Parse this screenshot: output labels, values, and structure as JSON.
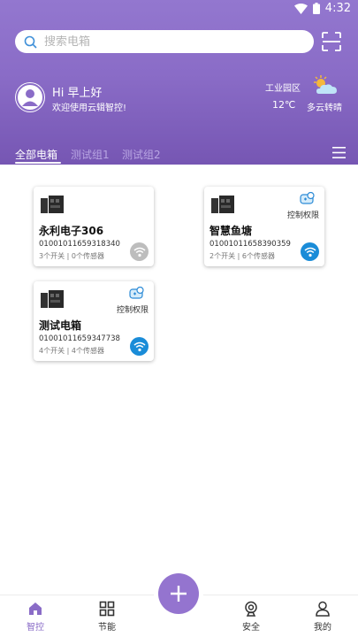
{
  "status_bar": {
    "time": "4:32",
    "icons": [
      "wifi-icon",
      "battery-icon"
    ]
  },
  "search": {
    "placeholder": "搜索电箱"
  },
  "user": {
    "greeting": "Hi 早上好",
    "welcome": "欢迎使用云辑智控!"
  },
  "weather": {
    "location": "工业园区",
    "temperature": "12℃",
    "condition": "多云转晴"
  },
  "tabs": [
    {
      "label": "全部电箱",
      "active": true
    },
    {
      "label": "测试组1",
      "active": false
    },
    {
      "label": "测试组2",
      "active": false
    }
  ],
  "cards": [
    {
      "name": "永利电子306",
      "code": "010010116593183​40",
      "meta": "3个开关 | 0个传感器",
      "permission": "",
      "online": false
    },
    {
      "name": "智慧鱼塘",
      "code": "010010116583903​59",
      "meta": "2个开关 | 6个传感器",
      "permission": "控制权限",
      "online": true
    },
    {
      "name": "测试电箱",
      "code": "010010116593477​38",
      "meta": "4个开关 | 4个传感器",
      "permission": "控制权限",
      "online": true
    }
  ],
  "nav": [
    {
      "label": "智控",
      "icon": "home-icon",
      "active": true
    },
    {
      "label": "节能",
      "icon": "grid-icon",
      "active": false
    },
    {
      "label": "安全",
      "icon": "camera-icon",
      "active": false
    },
    {
      "label": "我的",
      "icon": "user-icon",
      "active": false
    }
  ],
  "colors": {
    "primary": "#8a6cc7",
    "online": "#1a8cd8",
    "offline": "#bdbdbd"
  }
}
